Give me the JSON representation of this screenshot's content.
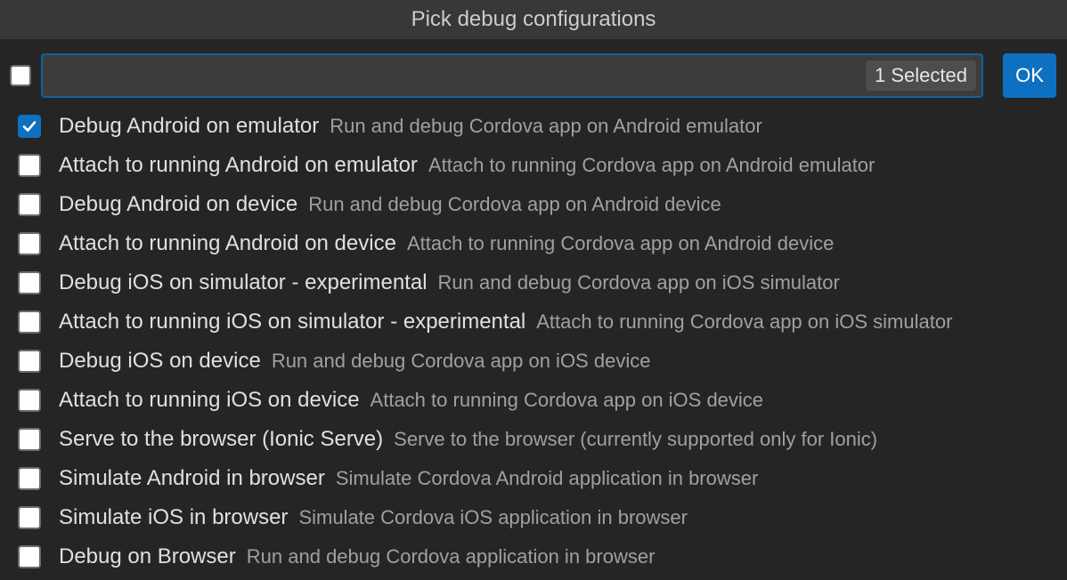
{
  "title": "Pick debug configurations",
  "filter": {
    "value": "",
    "placeholder": "",
    "selected_count": "1 Selected"
  },
  "ok_label": "OK",
  "colors": {
    "accent": "#0e70c0",
    "focus_border": "#0e639c",
    "background": "#252526",
    "title_bar": "#383838"
  },
  "items": [
    {
      "label": "Debug Android on emulator",
      "description": "Run and debug Cordova app on Android emulator",
      "checked": true
    },
    {
      "label": "Attach to running Android on emulator",
      "description": "Attach to running Cordova app on Android emulator",
      "checked": false
    },
    {
      "label": "Debug Android on device",
      "description": "Run and debug Cordova app on Android device",
      "checked": false
    },
    {
      "label": "Attach to running Android on device",
      "description": "Attach to running Cordova app on Android device",
      "checked": false
    },
    {
      "label": "Debug iOS on simulator - experimental",
      "description": "Run and debug Cordova app on iOS simulator",
      "checked": false
    },
    {
      "label": "Attach to running iOS on simulator - experimental",
      "description": "Attach to running Cordova app on iOS simulator",
      "checked": false
    },
    {
      "label": "Debug iOS on device",
      "description": "Run and debug Cordova app on iOS device",
      "checked": false
    },
    {
      "label": "Attach to running iOS on device",
      "description": "Attach to running Cordova app on iOS device",
      "checked": false
    },
    {
      "label": "Serve to the browser (Ionic Serve)",
      "description": "Serve to the browser (currently supported only for Ionic)",
      "checked": false
    },
    {
      "label": "Simulate Android in browser",
      "description": "Simulate Cordova Android application in browser",
      "checked": false
    },
    {
      "label": "Simulate iOS in browser",
      "description": "Simulate Cordova iOS application in browser",
      "checked": false
    },
    {
      "label": "Debug on Browser",
      "description": "Run and debug Cordova application in browser",
      "checked": false
    }
  ]
}
